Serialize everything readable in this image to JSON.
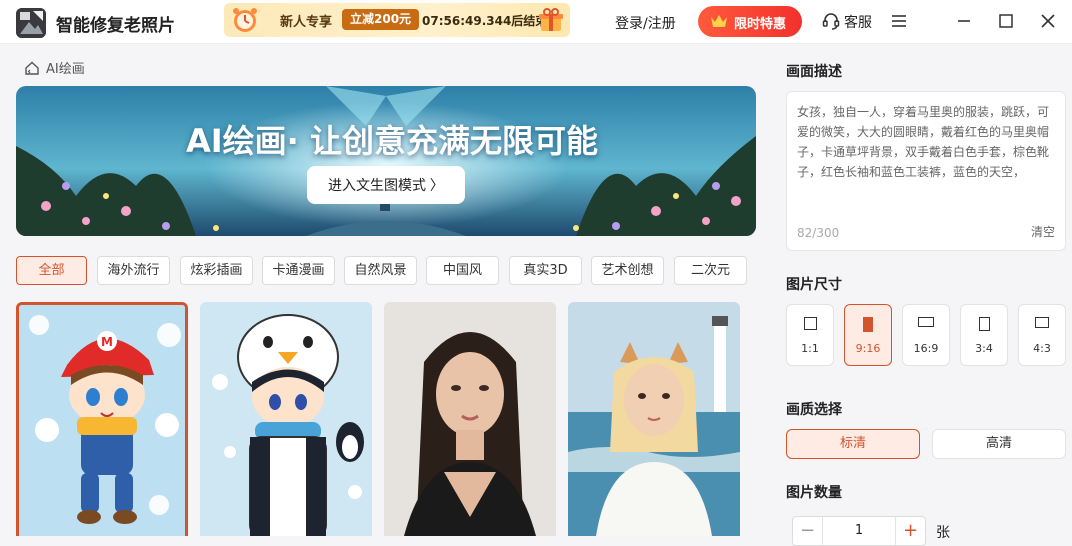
{
  "app": {
    "title": "智能修复老照片",
    "logo_icon": "photo-restore-logo"
  },
  "promo": {
    "label": "新人专享",
    "badge": "立减200元",
    "timer": "07:56:49.344后结束"
  },
  "header": {
    "login_label": "登录/注册",
    "special_label": "限时特惠",
    "service_label": "客服"
  },
  "breadcrumb": {
    "label": "AI绘画"
  },
  "banner": {
    "title": "AI绘画· 让创意充满无限可能",
    "button_label": "进入文生图模式 〉"
  },
  "tabs": [
    {
      "label": "全部",
      "active": true
    },
    {
      "label": "海外流行"
    },
    {
      "label": "炫彩插画"
    },
    {
      "label": "卡通漫画"
    },
    {
      "label": "自然风景"
    },
    {
      "label": "中国风"
    },
    {
      "label": "真实3D"
    },
    {
      "label": "艺术创想"
    },
    {
      "label": "二次元"
    }
  ],
  "gallery": [
    {
      "name": "cartoon-mario-girl"
    },
    {
      "name": "penguin-hood-girl"
    },
    {
      "name": "realistic-portrait-woman"
    },
    {
      "name": "cat-ear-girl-seaside"
    }
  ],
  "panel": {
    "description_title": "画面描述",
    "description_text": "女孩，独自一人，穿着马里奥的服装，跳跃，可爱的微笑，大大的圆眼睛，戴着红色的马里奥帽子，卡通草坪背景，双手戴着白色手套，棕色靴子，红色长袖和蓝色工装裤，蓝色的天空，",
    "description_count": "82/300",
    "clear_label": "清空",
    "size_title": "图片尺寸",
    "sizes": [
      {
        "label": "1:1"
      },
      {
        "label": "9:16",
        "active": true
      },
      {
        "label": "16:9"
      },
      {
        "label": "3:4"
      },
      {
        "label": "4:3"
      }
    ],
    "quality_title": "画质选择",
    "qualities": [
      {
        "label": "标清",
        "active": true
      },
      {
        "label": "高清"
      }
    ],
    "count_title": "图片数量",
    "count_value": "1",
    "count_unit": "张",
    "minus_label": "−",
    "plus_label": "+"
  },
  "colors": {
    "accent": "#d2542c",
    "accent_bg": "#fdebe4",
    "special_red": "#f2312c"
  }
}
